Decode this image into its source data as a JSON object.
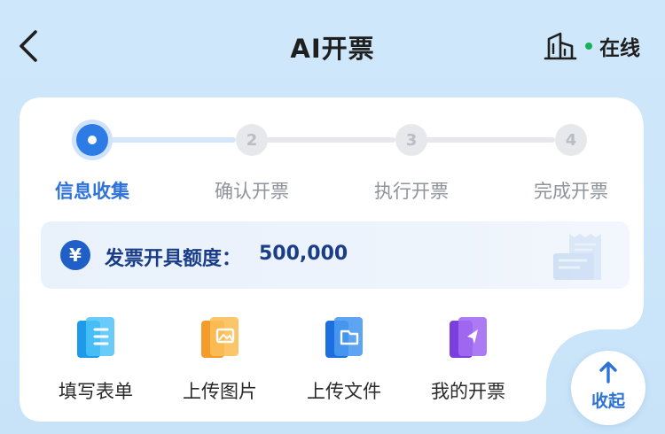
{
  "header": {
    "title": "AI开票",
    "status_text": "在线",
    "icons": {
      "back": "back-arrow-icon",
      "building": "building-icon"
    }
  },
  "colors": {
    "accent": "#2d7ce6",
    "online": "#18b15a",
    "quota_text": "#1a3d88"
  },
  "steps": [
    {
      "number": "1",
      "label": "信息收集",
      "active": true
    },
    {
      "number": "2",
      "label": "确认开票",
      "active": false
    },
    {
      "number": "3",
      "label": "执行开票",
      "active": false
    },
    {
      "number": "4",
      "label": "完成开票",
      "active": false
    }
  ],
  "quota": {
    "icon_symbol": "¥",
    "label": "发票开具额度：",
    "value": "500,000"
  },
  "tools": [
    {
      "label": "填写表单",
      "icon": "form-icon"
    },
    {
      "label": "上传图片",
      "icon": "image-upload-icon"
    },
    {
      "label": "上传文件",
      "icon": "file-upload-icon"
    },
    {
      "label": "我的开票",
      "icon": "my-invoice-icon"
    }
  ],
  "collapse": {
    "label": "收起",
    "icon": "up-arrow-icon"
  }
}
